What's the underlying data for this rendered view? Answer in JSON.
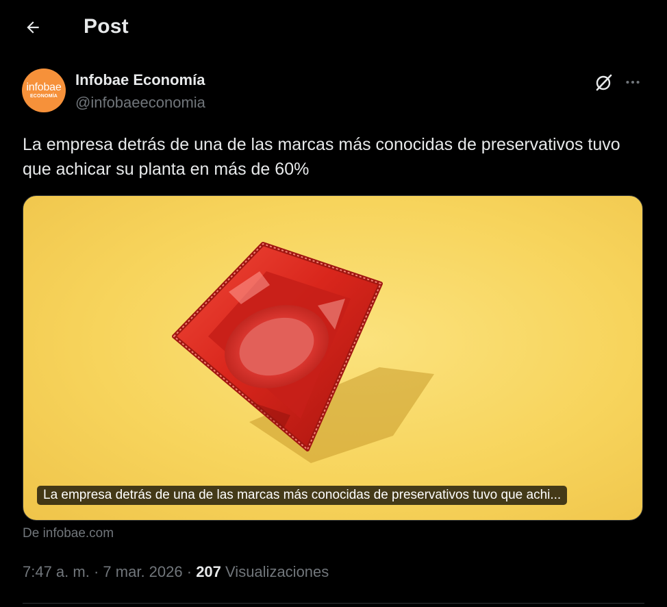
{
  "header": {
    "title": "Post",
    "back_icon": "arrow-left-icon"
  },
  "author": {
    "avatar": {
      "logo_main": "infobae",
      "logo_sub": "ECONOMÍA",
      "color": "#f6913a"
    },
    "name": "Infobae Economía",
    "handle": "@infobaeeconomia"
  },
  "actions": {
    "grok_icon": "grok-icon",
    "more_icon": "more-horizontal-icon"
  },
  "tweet": {
    "text": "La empresa detrás de una de las marcas más conocidas de preservativos tuvo que achicar su planta en más de 60%"
  },
  "card": {
    "caption": "La empresa detrás de una de las marcas más conocidas de preservativos tuvo que achi...",
    "source": "De infobae.com",
    "background_color": "#f7d45c",
    "object_color": "#d9261c"
  },
  "meta": {
    "time": "7:47 a. m.",
    "separator": "·",
    "date": "7 mar. 2026",
    "views_count": "207",
    "views_label": "Visualizaciones"
  }
}
